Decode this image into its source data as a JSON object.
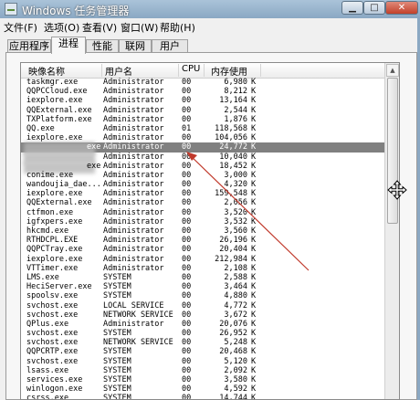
{
  "window": {
    "title": "Windows 任务管理器",
    "btn_min": "▁",
    "btn_max": "□",
    "btn_close": "✕"
  },
  "menu": [
    "文件(F)",
    "选项(O)",
    "查看(V)",
    "窗口(W)",
    "帮助(H)"
  ],
  "tabs": [
    "应用程序",
    "进程",
    "性能",
    "联网",
    "用户"
  ],
  "active_tab": "进程",
  "columns": {
    "name": "映像名称",
    "user": "用户名",
    "cpu": "CPU",
    "mem": "内存使用"
  },
  "processes": [
    {
      "name": "taskmgr.exe",
      "user": "Administrator",
      "cpu": "00",
      "mem": "6,980",
      "unit": "K"
    },
    {
      "name": "QQPCCloud.exe",
      "user": "Administrator",
      "cpu": "00",
      "mem": "8,212",
      "unit": "K"
    },
    {
      "name": "iexplore.exe",
      "user": "Administrator",
      "cpu": "00",
      "mem": "13,164",
      "unit": "K"
    },
    {
      "name": "QQExternal.exe",
      "user": "Administrator",
      "cpu": "00",
      "mem": "2,544",
      "unit": "K"
    },
    {
      "name": "TXPlatform.exe",
      "user": "Administrator",
      "cpu": "00",
      "mem": "1,876",
      "unit": "K"
    },
    {
      "name": "QQ.exe",
      "user": "Administrator",
      "cpu": "01",
      "mem": "118,568",
      "unit": "K"
    },
    {
      "name": "iexplore.exe",
      "user": "Administrator",
      "cpu": "00",
      "mem": "104,056",
      "unit": "K"
    },
    {
      "name": "exe",
      "user": "Administrator",
      "cpu": "00",
      "mem": "24,772",
      "unit": "K",
      "selected": true,
      "blurred": true
    },
    {
      "name": "",
      "user": "Administrator",
      "cpu": "00",
      "mem": "10,040",
      "unit": "K",
      "blurred": true
    },
    {
      "name": "exe",
      "user": "Administrator",
      "cpu": "00",
      "mem": "18,452",
      "unit": "K",
      "blurred": true
    },
    {
      "name": "conime.exe",
      "user": "Administrator",
      "cpu": "00",
      "mem": "3,000",
      "unit": "K"
    },
    {
      "name": "wandoujia_dae...",
      "user": "Administrator",
      "cpu": "00",
      "mem": "4,320",
      "unit": "K"
    },
    {
      "name": "iexplore.exe",
      "user": "Administrator",
      "cpu": "00",
      "mem": "159,548",
      "unit": "K"
    },
    {
      "name": "QQExternal.exe",
      "user": "Administrator",
      "cpu": "00",
      "mem": "2,056",
      "unit": "K"
    },
    {
      "name": "ctfmon.exe",
      "user": "Administrator",
      "cpu": "00",
      "mem": "3,520",
      "unit": "K"
    },
    {
      "name": "igfxpers.exe",
      "user": "Administrator",
      "cpu": "00",
      "mem": "3,532",
      "unit": "K"
    },
    {
      "name": "hkcmd.exe",
      "user": "Administrator",
      "cpu": "00",
      "mem": "3,560",
      "unit": "K"
    },
    {
      "name": "RTHDCPL.EXE",
      "user": "Administrator",
      "cpu": "00",
      "mem": "26,196",
      "unit": "K"
    },
    {
      "name": "QQPCTray.exe",
      "user": "Administrator",
      "cpu": "00",
      "mem": "20,404",
      "unit": "K"
    },
    {
      "name": "iexplore.exe",
      "user": "Administrator",
      "cpu": "00",
      "mem": "212,984",
      "unit": "K"
    },
    {
      "name": "VTTimer.exe",
      "user": "Administrator",
      "cpu": "00",
      "mem": "2,108",
      "unit": "K"
    },
    {
      "name": "LMS.exe",
      "user": "SYSTEM",
      "cpu": "00",
      "mem": "2,588",
      "unit": "K"
    },
    {
      "name": "HeciServer.exe",
      "user": "SYSTEM",
      "cpu": "00",
      "mem": "3,464",
      "unit": "K"
    },
    {
      "name": "spoolsv.exe",
      "user": "SYSTEM",
      "cpu": "00",
      "mem": "4,880",
      "unit": "K"
    },
    {
      "name": "svchost.exe",
      "user": "LOCAL SERVICE",
      "cpu": "00",
      "mem": "4,772",
      "unit": "K"
    },
    {
      "name": "svchost.exe",
      "user": "NETWORK SERVICE",
      "cpu": "00",
      "mem": "3,672",
      "unit": "K"
    },
    {
      "name": "QPlus.exe",
      "user": "Administrator",
      "cpu": "00",
      "mem": "20,076",
      "unit": "K"
    },
    {
      "name": "svchost.exe",
      "user": "SYSTEM",
      "cpu": "00",
      "mem": "26,952",
      "unit": "K"
    },
    {
      "name": "svchost.exe",
      "user": "NETWORK SERVICE",
      "cpu": "00",
      "mem": "5,248",
      "unit": "K"
    },
    {
      "name": "QQPCRTP.exe",
      "user": "SYSTEM",
      "cpu": "00",
      "mem": "20,468",
      "unit": "K"
    },
    {
      "name": "svchost.exe",
      "user": "SYSTEM",
      "cpu": "00",
      "mem": "5,120",
      "unit": "K"
    },
    {
      "name": "lsass.exe",
      "user": "SYSTEM",
      "cpu": "00",
      "mem": "2,092",
      "unit": "K"
    },
    {
      "name": "services.exe",
      "user": "SYSTEM",
      "cpu": "00",
      "mem": "3,580",
      "unit": "K"
    },
    {
      "name": "winlogon.exe",
      "user": "SYSTEM",
      "cpu": "00",
      "mem": "4,592",
      "unit": "K"
    },
    {
      "name": "csrss.exe",
      "user": "SYSTEM",
      "cpu": "00",
      "mem": "14,744",
      "unit": "K"
    }
  ],
  "colors": {
    "selection": "#808080",
    "annotation_arrow": "#c0392b",
    "title_bar": "#9bb6cf"
  },
  "icons": {
    "app": "task-manager-icon",
    "cursor": "move-cursor-icon",
    "annotation": "red-arrow-annotation"
  }
}
